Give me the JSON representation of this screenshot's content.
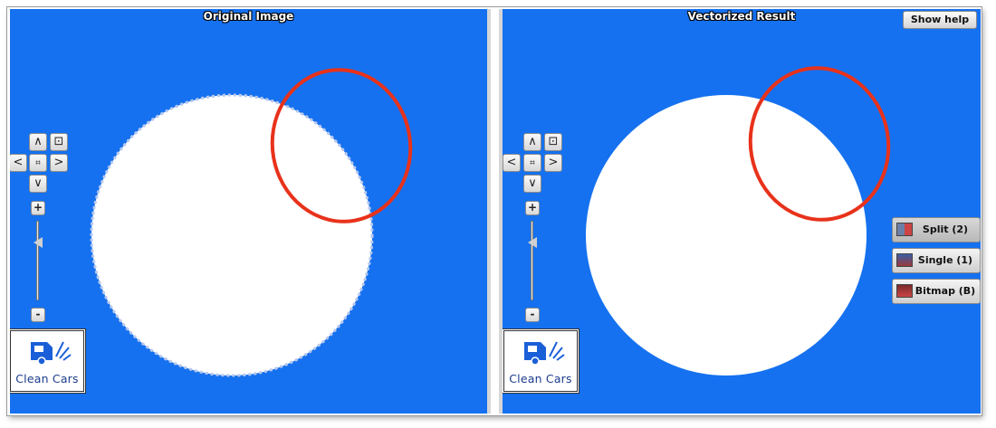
{
  "panels": {
    "left": {
      "title": "Original Image"
    },
    "right": {
      "title": "Vectorized Result"
    }
  },
  "controls": {
    "up": "∧",
    "down": "∨",
    "left": "<",
    "right": ">",
    "zoom_in": "+",
    "zoom_out": "-"
  },
  "logo": {
    "text": "Clean Cars"
  },
  "toolbar": {
    "help_label": "Show help",
    "modes": [
      {
        "label": "Split (2)",
        "active": true
      },
      {
        "label": "Single (1)",
        "active": false
      },
      {
        "label": "Bitmap (B)",
        "active": false
      }
    ]
  },
  "colors": {
    "canvas_blue": "#1571ef",
    "annotation_red": "#e8321b"
  }
}
